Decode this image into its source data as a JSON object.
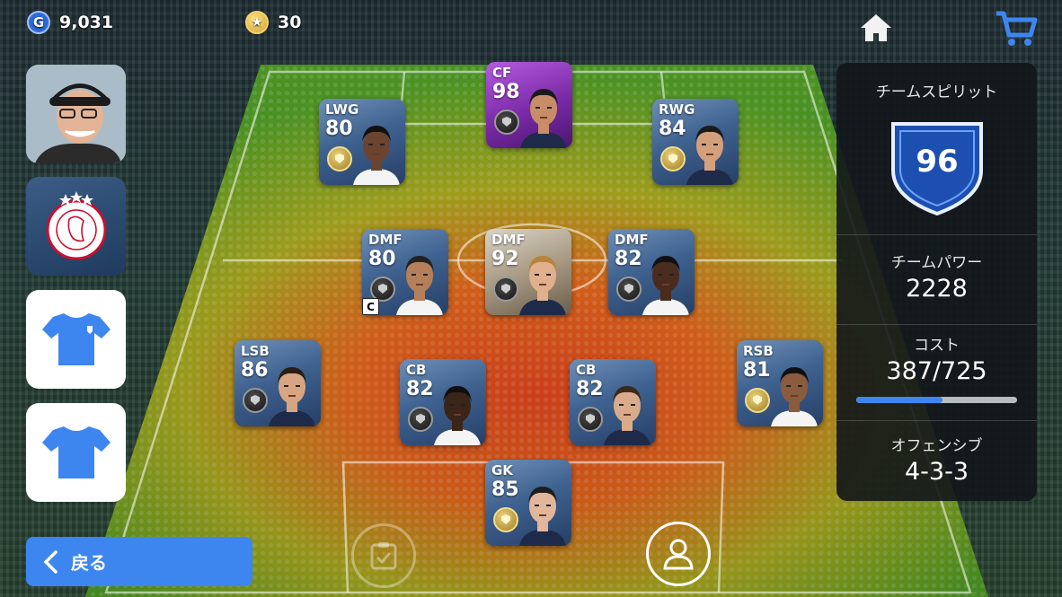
{
  "currency": {
    "gp": "9,031",
    "coins": "30"
  },
  "icons": {
    "gp": "G",
    "coin": "★"
  },
  "panel": {
    "team_spirit_label": "チームスピリット",
    "team_spirit_value": "96",
    "team_power_label": "チームパワー",
    "team_power_value": "2228",
    "cost_label": "コスト",
    "cost_value": "387/725",
    "cost_fraction": 0.534,
    "style_label": "オフェンシブ",
    "formation": "4-3-3"
  },
  "back_label": "戻る",
  "players": [
    {
      "pos": "CF",
      "ovr": "98",
      "style": "purple",
      "badge": "black"
    },
    {
      "pos": "LWG",
      "ovr": "80",
      "style": "blue",
      "badge": "gold"
    },
    {
      "pos": "RWG",
      "ovr": "84",
      "style": "blue",
      "badge": "gold"
    },
    {
      "pos": "DMF",
      "ovr": "80",
      "style": "blue",
      "badge": "black",
      "captain": "C"
    },
    {
      "pos": "DMF",
      "ovr": "92",
      "style": "legend",
      "badge": "black"
    },
    {
      "pos": "DMF",
      "ovr": "82",
      "style": "blue",
      "badge": "black"
    },
    {
      "pos": "LSB",
      "ovr": "86",
      "style": "blue",
      "badge": "black"
    },
    {
      "pos": "CB",
      "ovr": "82",
      "style": "blue",
      "badge": "black"
    },
    {
      "pos": "CB",
      "ovr": "82",
      "style": "blue",
      "badge": "black"
    },
    {
      "pos": "RSB",
      "ovr": "81",
      "style": "blue",
      "badge": "gold"
    },
    {
      "pos": "GK",
      "ovr": "85",
      "style": "blue",
      "badge": "gold"
    }
  ],
  "colors": {
    "accent": "#3d86f0",
    "shield": "#1d4fb0"
  }
}
